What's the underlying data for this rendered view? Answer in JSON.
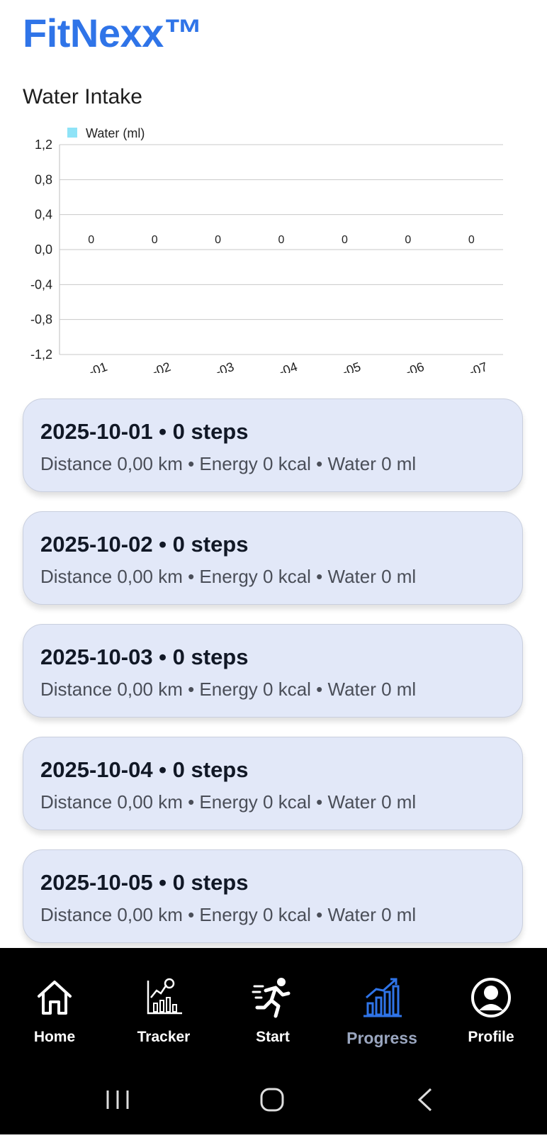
{
  "header": {
    "app_title": "FitNexx™"
  },
  "water_section": {
    "title": "Water Intake"
  },
  "chart_data": {
    "type": "bar",
    "series": [
      {
        "name": "Water (ml)",
        "color": "#8fe3f7",
        "values": [
          0,
          0,
          0,
          0,
          0,
          0,
          0
        ]
      }
    ],
    "data_labels": [
      "0",
      "0",
      "0",
      "0",
      "0",
      "0",
      "0"
    ],
    "y_ticks": [
      "1,2",
      "0,8",
      "0,4",
      "0,0",
      "-0,4",
      "-0,8",
      "-1,2"
    ],
    "x_tick_labels_visible": [
      "-01",
      "-02",
      "-03",
      "-04",
      "-05",
      "-06",
      "-07"
    ],
    "ylim": [
      -1.2,
      1.2
    ],
    "grid": true,
    "legend": "top-left"
  },
  "days": [
    {
      "title": "2025-10-01 • 0 steps",
      "summary": "Distance 0,00 km • Energy 0 kcal • Water 0 ml"
    },
    {
      "title": "2025-10-02 • 0 steps",
      "summary": "Distance 0,00 km • Energy 0 kcal • Water 0 ml"
    },
    {
      "title": "2025-10-03 • 0 steps",
      "summary": "Distance 0,00 km • Energy 0 kcal • Water 0 ml"
    },
    {
      "title": "2025-10-04 • 0 steps",
      "summary": "Distance 0,00 km • Energy 0 kcal • Water 0 ml"
    },
    {
      "title": "2025-10-05 • 0 steps",
      "summary": "Distance 0,00 km • Energy 0 kcal • Water 0 ml"
    }
  ],
  "nav": {
    "items": [
      {
        "label": "Home",
        "icon": "home-icon"
      },
      {
        "label": "Tracker",
        "icon": "tracker-chart-icon"
      },
      {
        "label": "Start",
        "icon": "running-person-icon"
      },
      {
        "label": "Progress",
        "icon": "bar-chart-icon",
        "active": true
      },
      {
        "label": "Profile",
        "icon": "profile-icon"
      }
    ],
    "active_color": "#2f74e8"
  },
  "system_bar": {
    "buttons": [
      "recents-icon",
      "home-button-icon",
      "back-icon"
    ]
  }
}
